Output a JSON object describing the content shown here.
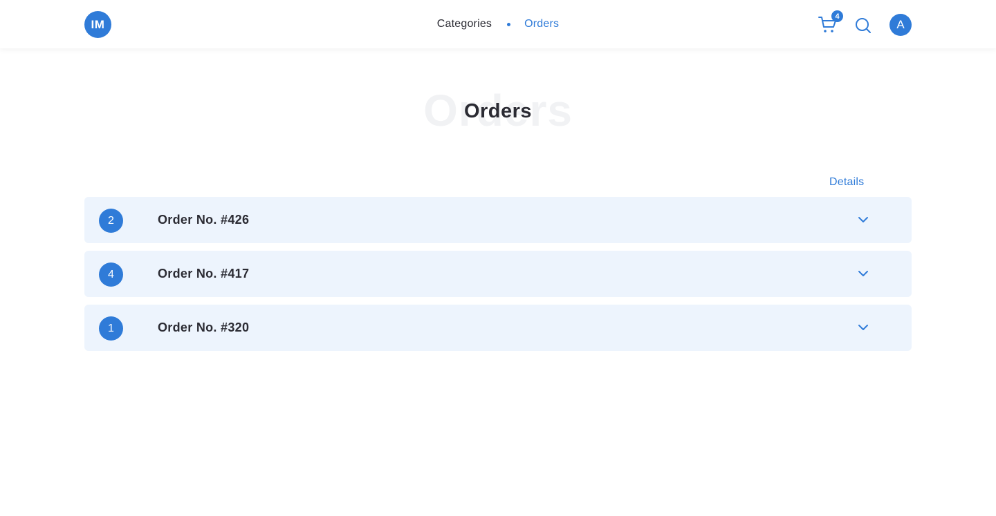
{
  "header": {
    "logo_text": "IM",
    "nav": [
      {
        "label": "Categories",
        "active": false
      },
      {
        "label": "Orders",
        "active": true
      }
    ],
    "cart_count": "4",
    "cart_icon": "cart-icon",
    "search_icon": "search-icon",
    "avatar_initial": "A"
  },
  "page": {
    "title_ghost": "Orders",
    "title": "Orders",
    "details_label": "Details"
  },
  "orders": [
    {
      "count": "2",
      "label": "Order No. #426"
    },
    {
      "count": "4",
      "label": "Order No. #417"
    },
    {
      "count": "1",
      "label": "Order No. #320"
    }
  ],
  "colors": {
    "accent": "#2f7bd8",
    "row_background": "#edf4fd",
    "text": "#2b2b33",
    "ghost_text": "#f1f2f4"
  }
}
